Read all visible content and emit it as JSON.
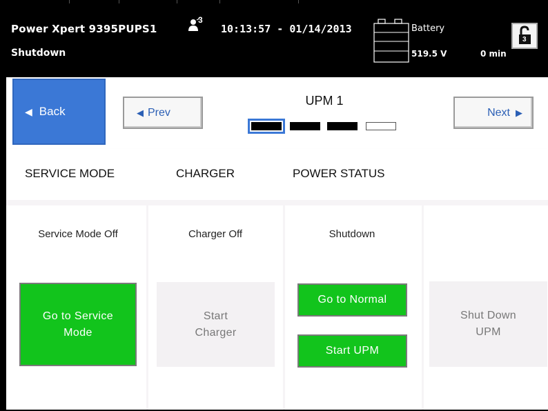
{
  "header": {
    "device_name": "Power Xpert 9395PUPS1",
    "system_status": "Shutdown",
    "datetime": "10:13:57 - 01/14/2013",
    "battery_label": "Battery",
    "battery_voltage": "519.5 V",
    "battery_runtime": "0 min",
    "user_icon": "user-level-icon",
    "lock_icon": "unlock-icon",
    "user_level": "3",
    "lock_level": "3"
  },
  "nav": {
    "back_label": "Back",
    "prev_label": "Prev",
    "next_label": "Next",
    "title": "UPM 1",
    "back_arrow": "◀",
    "prev_arrow": "◀",
    "next_arrow": "▶",
    "page_count": 4,
    "current_page": 1
  },
  "sections": {
    "service_mode": "SERVICE MODE",
    "charger": "CHARGER",
    "power_status": "POWER STATUS"
  },
  "panels": {
    "service_mode_state": "Service Mode Off",
    "charger_state": "Charger Off",
    "power_state": "Shutdown",
    "go_service_mode_line1": "Go to Service",
    "go_service_mode_line2": "Mode",
    "start_charger_line1": "Start",
    "start_charger_line2": "Charger",
    "go_normal": "Go to Normal",
    "start_upm": "Start UPM",
    "shut_down_line1": "Shut Down",
    "shut_down_line2": "UPM"
  },
  "colors": {
    "header_bg": "#000000",
    "back_button": "#3b78d6",
    "action_green": "#12c41c",
    "disabled_bg": "#f3f1f3",
    "link_blue": "#2b5fb5"
  }
}
